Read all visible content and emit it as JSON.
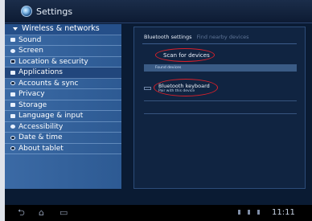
{
  "window": {
    "title": "Settings"
  },
  "sidebar": {
    "items": [
      {
        "label": "Wireless & networks",
        "icon": "triangle-down-icon"
      },
      {
        "label": "Sound",
        "icon": "speaker-icon"
      },
      {
        "label": "Screen",
        "icon": "screen-icon"
      },
      {
        "label": "Location & security",
        "icon": "lock-icon"
      },
      {
        "label": "Applications",
        "icon": "applications-icon"
      },
      {
        "label": "Accounts & sync",
        "icon": "sync-icon"
      },
      {
        "label": "Privacy",
        "icon": "privacy-icon"
      },
      {
        "label": "Storage",
        "icon": "storage-icon"
      },
      {
        "label": "Language & input",
        "icon": "keyboard-icon"
      },
      {
        "label": "Accessibility",
        "icon": "accessibility-icon"
      },
      {
        "label": "Date & time",
        "icon": "clock-icon"
      },
      {
        "label": "About tablet",
        "icon": "info-icon"
      }
    ]
  },
  "panel": {
    "tabs": {
      "active": "Bluetooth settings",
      "inactive": "Find nearby devices"
    },
    "scan_label": "Scan for devices",
    "found_label": "Found devices",
    "device": {
      "name": "Bluetooth keyboard",
      "subtitle": "Pair with this device"
    }
  },
  "status": {
    "time": "11:11"
  },
  "colors": {
    "annotation": "#d8202a",
    "sidebar": "#3b6aa5",
    "panel": "#102441"
  }
}
